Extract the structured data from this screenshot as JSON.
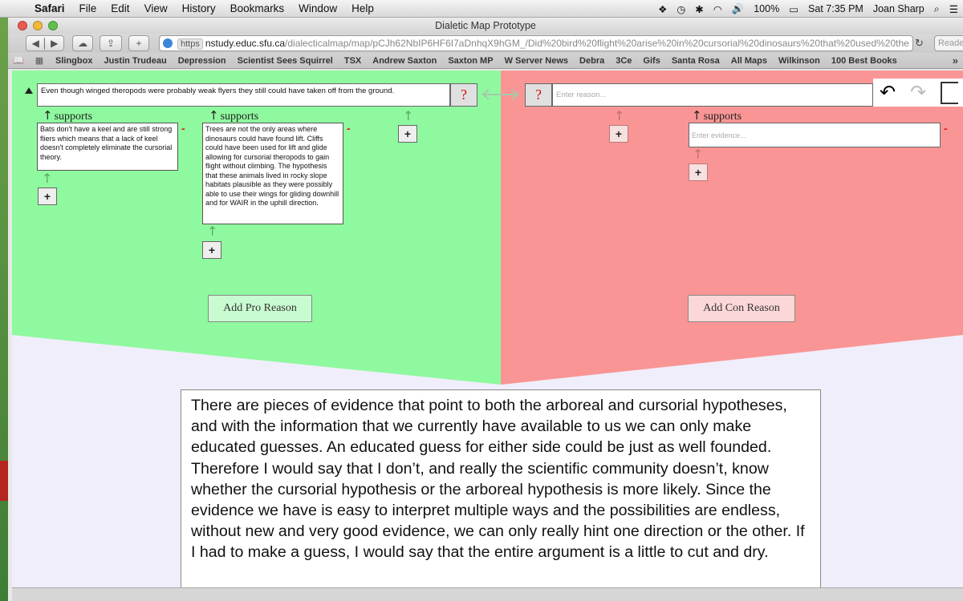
{
  "menubar": {
    "app": "Safari",
    "items": [
      "File",
      "Edit",
      "View",
      "History",
      "Bookmarks",
      "Window",
      "Help"
    ],
    "battery": "100%",
    "clock": "Sat 7:35 PM",
    "user": "Joan Sharp"
  },
  "window": {
    "title": "Dialetic Map Prototype"
  },
  "toolbar": {
    "url_scheme": "https",
    "url_host": "nstudy.educ.sfu.ca",
    "url_path": "/dialecticalmap/map/pCJh62NbIP6HF6I7aDnhqX9hGM_/Did%20bird%20flight%20arise%20in%20cursorial%20dinosaurs%20that%20used%20the",
    "reader_label": "Reade"
  },
  "bookmarks": [
    "Slingbox",
    "Justin Trudeau",
    "Depression",
    "Scientist Sees Squirrel",
    "TSX",
    "Andrew Saxton",
    "Saxton MP",
    "W Server News",
    "Debra",
    "3Ce",
    "Gifs",
    "Santa Rosa",
    "All Maps",
    "Wilkinson",
    "100 Best Books"
  ],
  "map": {
    "claim": "Even though winged theropods were probably weak flyers they still could have taken off from the ground.",
    "question_mark": "?",
    "supports_label": "supports",
    "pro_evidence": [
      "Bats don't have a keel and are still strong fliers which means that a lack of keel doesn't completely eliminate the cursorial theory.",
      "Trees are not the only areas where dinosaurs could have found lift. Cliffs could have been used for lift and glide allowing for cursorial theropods to gain flight without climbing. The hypothesis that these animals lived in rocky slope habitats plausible as they were possibly able to use their wings for gliding downhill and for WAIR in the uphill direction."
    ],
    "con_reason_placeholder": "Enter reason...",
    "con_evidence_placeholder": "Enter evidence...",
    "plus": "+",
    "minus": "-",
    "add_pro": "Add Pro Reason",
    "add_con": "Add Con Reason"
  },
  "conclusion": "There are pieces of evidence that point to both the arboreal and cursorial hypotheses, and with the information that we currently have available to us we can only make educated guesses. An educated guess for either side could be just as well founded. Therefore I would say that I don’t, and really the scientific community doesn’t, know whether the cursorial hypothesis or the arboreal hypothesis is more likely. Since the evidence we have is easy to interpret multiple ways and the possibilities are endless, without new and very good evidence, we can only really hint one direction or the other. If I had to make a guess, I would say that the entire argument is a little to cut and dry."
}
